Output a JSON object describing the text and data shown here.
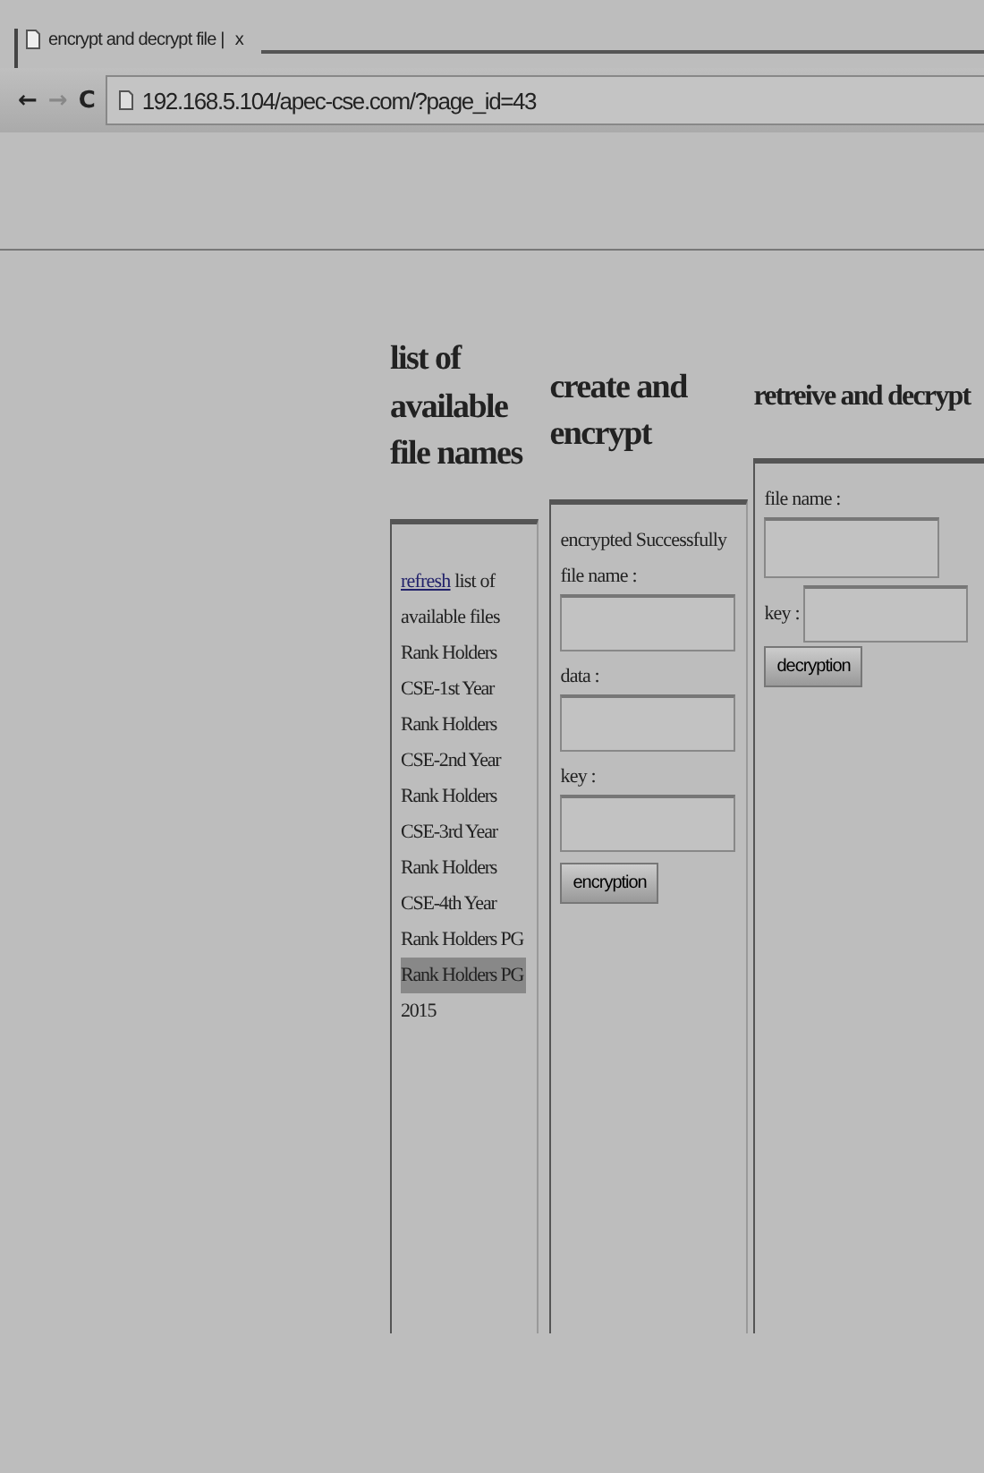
{
  "browser": {
    "tab_title": "encrypt and decrypt file |",
    "tab_close": "x",
    "back": "←",
    "forward": "→",
    "reload": "C",
    "url": "192.168.5.104/apec-cse.com/?page_id=43"
  },
  "list_panel": {
    "heading": "list of available file names",
    "refresh_link": "refresh",
    "refresh_text": "list of available files",
    "files": [
      {
        "name": "Rank Holders CSE-1st Year",
        "selected": false
      },
      {
        "name": "Rank Holders CSE-2nd Year",
        "selected": false
      },
      {
        "name": "Rank Holders CSE-3rd Year",
        "selected": false
      },
      {
        "name": "Rank Holders CSE-4th Year",
        "selected": false
      },
      {
        "name": "Rank Holders PG",
        "selected": false
      },
      {
        "name": "Rank Holders PG",
        "selected": true
      },
      {
        "name": "2015",
        "selected": false
      }
    ]
  },
  "create_panel": {
    "heading": "create and encrypt",
    "status": "encrypted Successfully",
    "fields": [
      {
        "label": "file name :"
      },
      {
        "label": "data :"
      },
      {
        "label": "key :"
      }
    ],
    "button": "encryption"
  },
  "retrieve_panel": {
    "heading": "retreive and decrypt",
    "file_label": "file name :",
    "key_label": "key :",
    "button": "decryption"
  }
}
